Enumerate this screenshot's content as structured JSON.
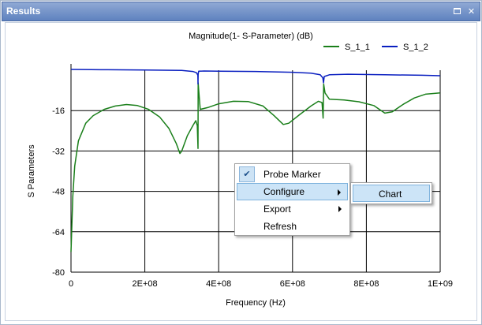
{
  "window": {
    "title": "Results"
  },
  "chart_data": {
    "type": "line",
    "title": "Magnitude(1- S-Parameter) (dB)",
    "xlabel": "Frequency (Hz)",
    "ylabel": "S Parameters",
    "xlim": [
      0,
      1000000000
    ],
    "ylim": [
      -80,
      0
    ],
    "x_ticks": [
      0,
      200000000,
      400000000,
      600000000,
      800000000,
      1000000000
    ],
    "x_tick_labels": [
      "0",
      "2E+08",
      "4E+08",
      "6E+08",
      "8E+08",
      "1E+09"
    ],
    "y_ticks": [
      -16,
      -32,
      -48,
      -64,
      -80
    ],
    "y_tick_labels": [
      "-16",
      "-32",
      "-48",
      "-64",
      "-80"
    ],
    "grid": true,
    "legend_position": "top-right",
    "series": [
      {
        "name": "S_1_1",
        "color": "#1a7f1a",
        "points": [
          [
            0,
            -72
          ],
          [
            5000000,
            -50
          ],
          [
            10000000,
            -38
          ],
          [
            20000000,
            -28
          ],
          [
            40000000,
            -21
          ],
          [
            60000000,
            -18
          ],
          [
            90000000,
            -15.5
          ],
          [
            120000000,
            -14.2
          ],
          [
            150000000,
            -13.6
          ],
          [
            180000000,
            -14.0
          ],
          [
            210000000,
            -15.5
          ],
          [
            240000000,
            -18.5
          ],
          [
            265000000,
            -23
          ],
          [
            285000000,
            -29
          ],
          [
            295000000,
            -33
          ],
          [
            300000000,
            -32
          ],
          [
            315000000,
            -26
          ],
          [
            330000000,
            -22
          ],
          [
            338000000,
            -20
          ],
          [
            342000000,
            -22
          ],
          [
            344000000,
            -31
          ],
          [
            344500000,
            -5
          ],
          [
            346000000,
            -8
          ],
          [
            350000000,
            -15.5
          ],
          [
            370000000,
            -14.8
          ],
          [
            400000000,
            -13.3
          ],
          [
            440000000,
            -12.3
          ],
          [
            480000000,
            -12.4
          ],
          [
            520000000,
            -14.2
          ],
          [
            550000000,
            -18
          ],
          [
            575000000,
            -21.5
          ],
          [
            590000000,
            -21
          ],
          [
            620000000,
            -17.5
          ],
          [
            650000000,
            -14.2
          ],
          [
            670000000,
            -12.3
          ],
          [
            680000000,
            -12.8
          ],
          [
            683000000,
            -19
          ],
          [
            684500000,
            -5.5
          ],
          [
            688000000,
            -9
          ],
          [
            700000000,
            -11.5
          ],
          [
            740000000,
            -11.8
          ],
          [
            780000000,
            -12.5
          ],
          [
            820000000,
            -14
          ],
          [
            850000000,
            -17
          ],
          [
            870000000,
            -16.5
          ],
          [
            900000000,
            -13.5
          ],
          [
            930000000,
            -11
          ],
          [
            960000000,
            -9.5
          ],
          [
            1000000000,
            -9
          ]
        ]
      },
      {
        "name": "S_1_2",
        "color": "#0a1fc0",
        "points": [
          [
            0,
            0.3
          ],
          [
            100000000,
            0.2
          ],
          [
            200000000,
            0.1
          ],
          [
            300000000,
            -0.1
          ],
          [
            330000000,
            -0.5
          ],
          [
            340000000,
            -1.0
          ],
          [
            343500000,
            -2.0
          ],
          [
            344000000,
            -5.5
          ],
          [
            344500000,
            -1.5
          ],
          [
            346000000,
            -0.4
          ],
          [
            360000000,
            -0.3
          ],
          [
            400000000,
            -0.4
          ],
          [
            500000000,
            -0.5
          ],
          [
            600000000,
            -0.8
          ],
          [
            650000000,
            -1.2
          ],
          [
            675000000,
            -1.8
          ],
          [
            682000000,
            -3
          ],
          [
            684000000,
            -5
          ],
          [
            686000000,
            -2.5
          ],
          [
            700000000,
            -1.8
          ],
          [
            750000000,
            -1.6
          ],
          [
            850000000,
            -1.8
          ],
          [
            950000000,
            -2.0
          ],
          [
            1000000000,
            -2.2
          ]
        ]
      }
    ]
  },
  "context_menu": {
    "items": [
      {
        "label": "Probe Marker",
        "checked": true
      },
      {
        "label": "Configure",
        "submenu": true,
        "highlighted": true
      },
      {
        "label": "Export",
        "submenu": true
      },
      {
        "label": "Refresh"
      }
    ],
    "submenu_items": [
      {
        "label": "Chart"
      }
    ]
  }
}
